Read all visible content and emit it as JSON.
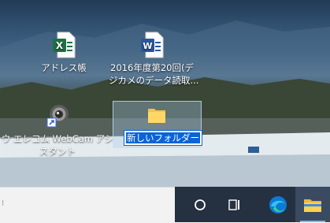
{
  "desktop": {
    "icons": [
      {
        "id": "excel",
        "label": "アドレス帳",
        "icon": "excel-file-icon"
      },
      {
        "id": "word",
        "label_line1": "2016年度第20回(デ",
        "label_line2": "ジカメのデータ読取...",
        "icon": "word-file-icon"
      },
      {
        "id": "webcam",
        "label_line1": "ウ エレコム WebCam アシ",
        "label_line2": "スタント",
        "icon": "webcam-shortcut-icon"
      },
      {
        "id": "new-folder",
        "rename_value": "新しいフォルダー",
        "icon": "folder-icon"
      }
    ]
  },
  "taskbar": {
    "buttons": [
      {
        "name": "cortana-button",
        "icon": "circle-icon"
      },
      {
        "name": "task-view-button",
        "icon": "task-view-icon"
      },
      {
        "name": "edge-button",
        "icon": "edge-browser-icon"
      },
      {
        "name": "file-explorer-button",
        "icon": "file-explorer-icon",
        "active": true
      }
    ],
    "colors": {
      "taskbar": "#253041",
      "accent": "#0a64d6"
    }
  }
}
